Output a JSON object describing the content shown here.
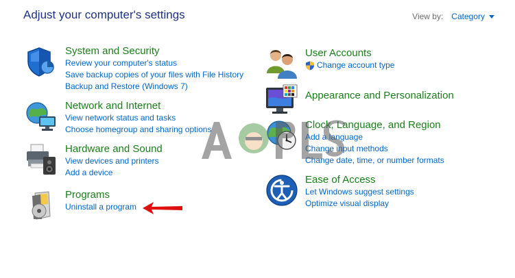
{
  "page": {
    "title": "Adjust your computer's settings"
  },
  "view_by": {
    "label": "View by:",
    "value": "Category"
  },
  "categories": {
    "system_security": {
      "title": "System and Security",
      "icon": "shield-icon",
      "links": [
        "Review your computer's status",
        "Save backup copies of your files with File History",
        "Backup and Restore (Windows 7)"
      ]
    },
    "network": {
      "title": "Network and Internet",
      "icon": "network-globe-icon",
      "links": [
        "View network status and tasks",
        "Choose homegroup and sharing options"
      ]
    },
    "hardware": {
      "title": "Hardware and Sound",
      "icon": "printer-speaker-icon",
      "links": [
        "View devices and printers",
        "Add a device"
      ]
    },
    "programs": {
      "title": "Programs",
      "icon": "programs-disc-icon",
      "links": [
        "Uninstall a program"
      ]
    },
    "user_accounts": {
      "title": "User Accounts",
      "icon": "users-icon",
      "links": [
        "Change account type"
      ]
    },
    "appearance": {
      "title": "Appearance and Personalization",
      "icon": "monitor-palette-icon",
      "links": []
    },
    "clock": {
      "title": "Clock, Language, and Region",
      "icon": "clock-globe-icon",
      "links": [
        "Add a language",
        "Change input methods",
        "Change date, time, or number formats"
      ]
    },
    "ease": {
      "title": "Ease of Access",
      "icon": "ease-of-access-icon",
      "links": [
        "Let Windows suggest settings",
        "Optimize visual display"
      ]
    }
  },
  "colors": {
    "title_blue": "#1e3287",
    "link_blue": "#0066cc",
    "category_green": "#1a7f1a",
    "arrow_red": "#e01010"
  }
}
